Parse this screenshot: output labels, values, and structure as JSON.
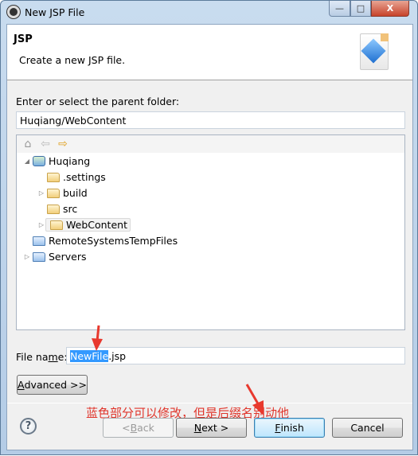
{
  "window": {
    "title": "New JSP File",
    "controls": {
      "minimize": "—",
      "maximize": "□",
      "close": "X"
    }
  },
  "header": {
    "title": "JSP",
    "description": "Create a new JSP file."
  },
  "folder": {
    "label": "Enter or select the parent folder:",
    "value": "Huqiang/WebContent"
  },
  "tree": {
    "items": [
      {
        "label": "Huqiang",
        "type": "project",
        "expanded": true
      },
      {
        "label": ".settings",
        "type": "folder"
      },
      {
        "label": "build",
        "type": "folder",
        "expandable": true
      },
      {
        "label": "src",
        "type": "folder"
      },
      {
        "label": "WebContent",
        "type": "folder",
        "expandable": true,
        "selected": true
      },
      {
        "label": "RemoteSystemsTempFiles",
        "type": "project-folder"
      },
      {
        "label": "Servers",
        "type": "project-folder",
        "expandable": true
      }
    ]
  },
  "annotation": "蓝色部分可以修改，但是后缀名别动他",
  "file_name": {
    "label_pre": "File na",
    "label_u": "m",
    "label_post": "e:",
    "selected_part": "NewFile",
    "rest": ".jsp"
  },
  "buttons": {
    "advanced": {
      "u": "A",
      "rest": "dvanced >>"
    },
    "back": {
      "pre": "< ",
      "u": "B",
      "rest": "ack"
    },
    "next": {
      "u": "N",
      "rest": "ext >"
    },
    "finish": {
      "u": "F",
      "rest": "inish"
    },
    "cancel": "Cancel",
    "help": "?"
  },
  "colors": {
    "annotation": "#e0352b",
    "selection": "#3399ff"
  }
}
